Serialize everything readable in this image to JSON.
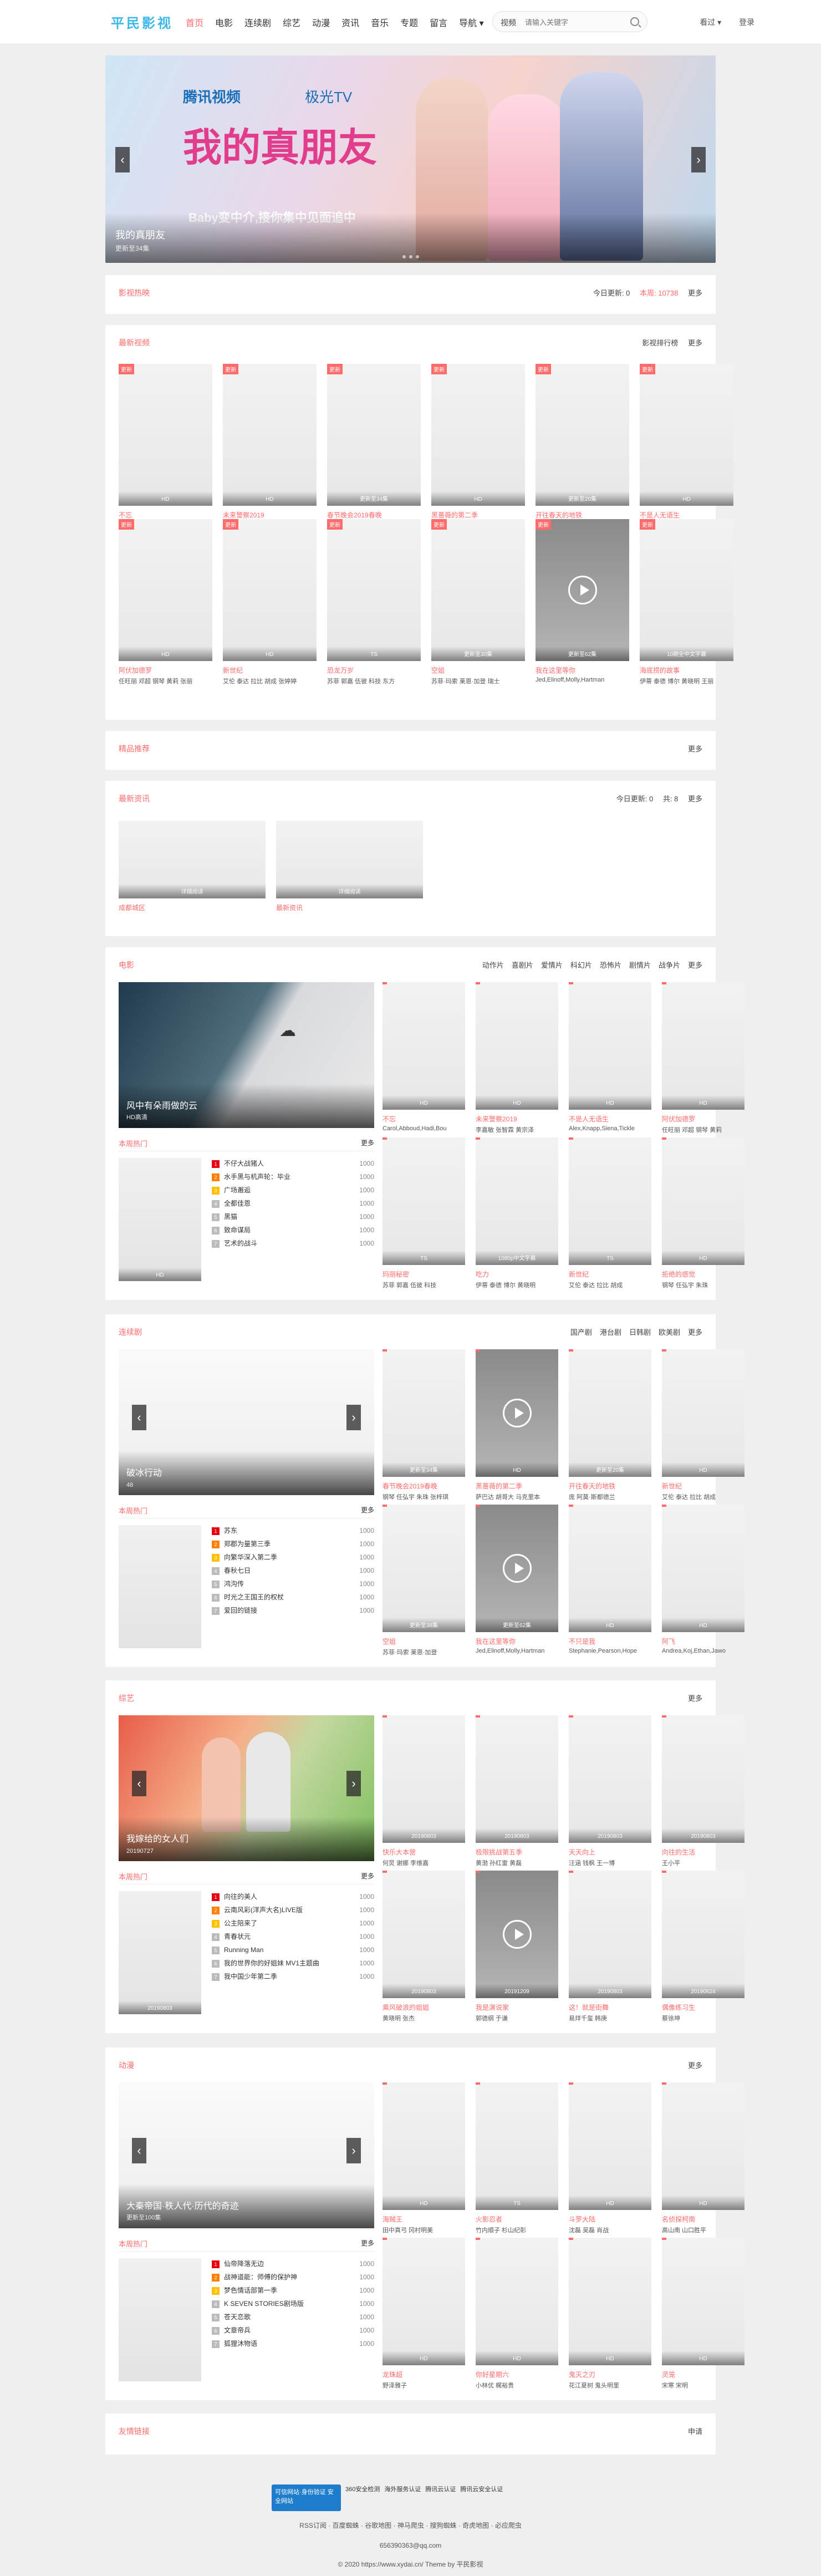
{
  "site": {
    "logo": "平民影视"
  },
  "nav": [
    "首页",
    "电影",
    "连续剧",
    "综艺",
    "动漫",
    "资讯",
    "音乐",
    "专题",
    "留言",
    "导航 ▾",
    "视频 ▾"
  ],
  "search": {
    "placeholder": "请输入关键字",
    "type": "视频"
  },
  "toplinks": [
    "看过 ▾",
    "登录"
  ],
  "banner": {
    "brand1": "腾讯视频",
    "brand2": "极光TV",
    "big": "我的真朋友",
    "slogan": "Baby变中介,接你集中见面追中",
    "caption": "我的真朋友",
    "sub": "更新至34集"
  },
  "sections": {
    "hot": {
      "title": "影视热映",
      "right": [
        "今日更新: 0",
        "本周: 10738",
        "更多"
      ]
    },
    "latest": {
      "title": "最新视频",
      "right": [
        "影视排行榜",
        "更多"
      ]
    },
    "recommend": {
      "title": "精品推荐",
      "right": [
        "更多"
      ]
    },
    "news": {
      "title": "最新资讯",
      "right": [
        "今日更新: 0",
        "共: 8",
        "更多"
      ]
    },
    "movie": {
      "title": "电影",
      "right": [
        "动作片",
        "喜剧片",
        "爱情片",
        "科幻片",
        "恐怖片",
        "剧情片",
        "战争片",
        "更多"
      ]
    },
    "tv": {
      "title": "连续剧",
      "right": [
        "国产剧",
        "港台剧",
        "日韩剧",
        "欧美剧",
        "更多"
      ]
    },
    "variety": {
      "title": "综艺",
      "right": [
        "更多"
      ]
    },
    "anime": {
      "title": "动漫",
      "right": [
        "更多"
      ]
    },
    "links": {
      "title": "友情链接",
      "right": [
        "申请"
      ]
    }
  },
  "latest_items": [
    {
      "b": "更新",
      "ov": "HD",
      "t": "不忘",
      "a": "Carol,Abboud,Hadi,Bou,Ayes"
    },
    {
      "b": "更新",
      "ov": "HD",
      "t": "未来警察2019",
      "a": "李嘉敏 张智霖 黄宗泽 刘杉"
    },
    {
      "b": "更新",
      "ov": "更新至34集",
      "t": "春节晚会2019春晚",
      "a": "钢琴 任弘宇 朱珠 张梓琪"
    },
    {
      "b": "更新",
      "ov": "HD",
      "t": "黑蔷薇的第二季",
      "a": "萨巴达 胡哥大 马克里本 美国"
    },
    {
      "b": "更新",
      "ov": "更新至20集",
      "t": "开往春天的地铁",
      "a": "庞 阿莫·斯都德兰"
    },
    {
      "b": "更新",
      "ov": "HD",
      "t": "不是人无语生",
      "a": "Alex,Knapp,Siena,Tickle,Ashe"
    },
    {
      "b": "更新",
      "ov": "HD",
      "t": "阿伏加德罗",
      "a": "任旺丽 邓超 钢琴 黄莉 张丽"
    },
    {
      "b": "更新",
      "ov": "HD",
      "t": "新世纪",
      "a": "艾伦 泰达 拉比 胡成 张婷婷"
    },
    {
      "b": "更新",
      "ov": "TS",
      "t": "恐龙万岁",
      "a": "苏菲 郭嘉 伍彼 科技 东方"
    },
    {
      "b": "更新",
      "ov": "更新至30集",
      "t": "空姐",
      "a": "苏菲·玛索 莱恩·加登 瑞士"
    },
    {
      "b": "更新",
      "ov": "更新至62集",
      "t": "我在这里等你",
      "a": "Jed,Elinoff,Molly,Hartman"
    },
    {
      "b": "更新",
      "ov": "10期全中文字幕",
      "t": "海底捞的故事",
      "a": "伊蒂 泰德 博尔 黄晓明 王丽"
    }
  ],
  "news_items": [
    {
      "t": "成都城区",
      "ov": "详细阅读"
    },
    {
      "t": "最新资讯",
      "ov": "详细阅读"
    }
  ],
  "movie_feat": {
    "cap": "风中有朵雨做的云",
    "sub": "HD高清"
  },
  "movie_items": [
    {
      "ov": "HD",
      "t": "不忘",
      "a": "Carol,Abboud,Hadi,Bou"
    },
    {
      "ov": "HD",
      "t": "未来警察2019",
      "a": "李嘉敏 张智霖 黄宗泽"
    },
    {
      "ov": "HD",
      "t": "不是人无语生",
      "a": "Alex,Knapp,Siena,Tickle"
    },
    {
      "ov": "HD",
      "t": "阿伏加德罗",
      "a": "任旺丽 邓超 钢琴 黄莉"
    },
    {
      "ov": "TS",
      "t": "玛丽秘密",
      "a": "苏菲 郭嘉 伍彼 科技"
    },
    {
      "ov": "1080p中文字幕",
      "t": "吃力",
      "a": "伊蒂 泰德 博尔 黄晓明"
    },
    {
      "ov": "TS",
      "t": "新世纪",
      "a": "艾伦 泰达 拉比 胡成"
    },
    {
      "ov": "HD",
      "t": "拒绝的感觉",
      "a": "钢琴 任弘宇 朱珠"
    }
  ],
  "movie_rank": {
    "head": "本周热门",
    "more": "更多",
    "thumb": "HD",
    "list": [
      "不仔大战猪人",
      "水手黑与机声轮：毕业",
      "广场邂逅",
      "全都佳恩",
      "黑猫",
      "致命谋局",
      "艺术的战斗"
    ],
    "vals": [
      "1000",
      "1000",
      "1000",
      "1000",
      "1000",
      "1000",
      "1000"
    ]
  },
  "tv_feat": {
    "cap": "破冰行动",
    "sub": "48"
  },
  "tv_items": [
    {
      "ov": "更新至34集",
      "t": "春节晚会2019春晚",
      "a": "钢琴 任弘宇 朱珠 张梓琪"
    },
    {
      "ov": "HD",
      "t": "黑蔷薇的第二季",
      "a": "萨巴达 胡哥大 马克里本"
    },
    {
      "ov": "更新至20集",
      "t": "开往春天的地铁",
      "a": "庞 阿莫·斯都德兰"
    },
    {
      "ov": "HD",
      "t": "新世纪",
      "a": "艾伦 泰达 拉比 胡成"
    },
    {
      "ov": "更新至38集",
      "t": "空姐",
      "a": "苏菲·玛索 莱恩·加登"
    },
    {
      "ov": "更新至62集",
      "t": "我在这里等你",
      "a": "Jed,Elinoff,Molly,Hartman"
    },
    {
      "ov": "HD",
      "t": "不只是我",
      "a": "Stephanie,Pearson,Hope"
    },
    {
      "ov": "HD",
      "t": "阿飞",
      "a": "Andrea,Koj,Ethan,Jawo"
    }
  ],
  "tv_rank": {
    "head": "本周热门",
    "more": "更多",
    "list": [
      "苏东",
      "郑郡为量第三季",
      "向繁华深入第二季",
      "春秋七日",
      "鸿沟传",
      "时光之王国王的权杖",
      "爱回的链接"
    ],
    "vals": [
      "1000",
      "1000",
      "1000",
      "1000",
      "1000",
      "1000",
      "1000"
    ]
  },
  "variety_feat": {
    "cap": "我嫁给的女人们",
    "sub": "20190727"
  },
  "variety_items": [
    {
      "ov": "20190803",
      "t": "快乐大本营",
      "a": "何炅 谢娜 李维嘉"
    },
    {
      "ov": "20190803",
      "t": "极限挑战第五季",
      "a": "黄渤 孙红雷 黄磊"
    },
    {
      "ov": "20190803",
      "t": "天天向上",
      "a": "汪涵 钱枫 王一博"
    },
    {
      "ov": "20190803",
      "t": "向往的生活",
      "a": "王小平"
    },
    {
      "ov": "20190803",
      "t": "乘风破浪的姐姐",
      "a": "黄晓明 张杰"
    },
    {
      "ov": "20191209",
      "t": "我是演说家",
      "a": "郭德纲 于谦"
    },
    {
      "ov": "20190803",
      "t": "这！就是街舞",
      "a": "易烊千玺 韩庚"
    },
    {
      "ov": "20190624",
      "t": "偶像练习生",
      "a": "蔡徐坤"
    }
  ],
  "variety_rank": {
    "head": "本周热门",
    "more": "更多",
    "thumb": "20190803",
    "list": [
      "向往的美人",
      "云南风彩(洋声大名)LIVE版",
      "公主陪来了",
      "青春状元",
      "Running Man",
      "我的世界你的好姐妹 MV1主题曲",
      "我中国少年第二季"
    ],
    "vals": [
      "1000",
      "1000",
      "1000",
      "1000",
      "1000",
      "1000",
      "1000"
    ]
  },
  "anime_feat": {
    "cap": "大秦帝国·秩人代·历代的奇迹",
    "sub": "更新至100集"
  },
  "anime_items": [
    {
      "ov": "HD",
      "t": "海贼王",
      "a": "田中真弓 冈村明美"
    },
    {
      "ov": "TS",
      "t": "火影忍者",
      "a": "竹内顺子 杉山纪彰"
    },
    {
      "ov": "HD",
      "t": "斗罗大陆",
      "a": "沈磊 吴磊 肖战"
    },
    {
      "ov": "HD",
      "t": "名侦探柯南",
      "a": "高山南 山口胜平"
    },
    {
      "ov": "HD",
      "t": "龙珠超",
      "a": "野泽雅子"
    },
    {
      "ov": "HD",
      "t": "你好星期六",
      "a": "小林优 梶裕贵"
    },
    {
      "ov": "HD",
      "t": "鬼灭之刃",
      "a": "花江夏树 鬼头明里"
    },
    {
      "ov": "HD",
      "t": "灵笼",
      "a": "宋寒 宋明"
    }
  ],
  "anime_rank": {
    "head": "本周热门",
    "more": "更多",
    "list": [
      "仙帝降落无边",
      "战神道能：师傅的保护神",
      "梦色情话部第一季",
      "K SEVEN STORIES剧场版",
      "苍天恋歌",
      "文章帝兵",
      "狐狸沐物语"
    ],
    "vals": [
      "1000",
      "1000",
      "1000",
      "1000",
      "1000",
      "1000",
      "1000"
    ]
  },
  "footer": {
    "shield": "可信网站·身份验证 安全网站",
    "badges": [
      "360安全检测",
      "海外服务认证",
      "腾讯云认证",
      "腾讯云安全认证"
    ],
    "links": "RSS订阅 · 百度蜘蛛 · 谷歌地图 · 神马爬虫 · 搜狗蜘蛛 · 奇虎地图 · 必应爬虫",
    "email": "656390363@qq.com",
    "copy": "© 2020 https://www.xydai.cn/ Theme by 平民影视"
  }
}
